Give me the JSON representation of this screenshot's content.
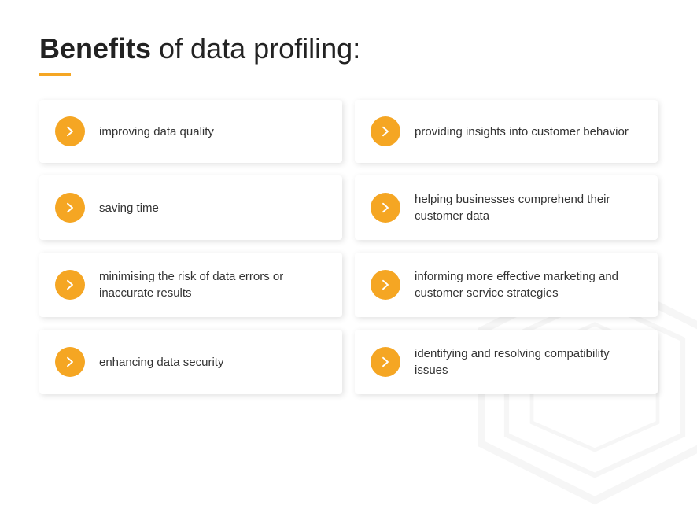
{
  "title": {
    "bold": "Benefits",
    "rest": " of data profiling:"
  },
  "cards": [
    {
      "id": "card-1",
      "text": "improving data quality"
    },
    {
      "id": "card-2",
      "text": "providing insights into customer behavior"
    },
    {
      "id": "card-3",
      "text": "saving time"
    },
    {
      "id": "card-4",
      "text": "helping businesses comprehend their customer data"
    },
    {
      "id": "card-5",
      "text": "minimising the risk of data errors or inaccurate results"
    },
    {
      "id": "card-6",
      "text": "informing more effective marketing and customer service strategies"
    },
    {
      "id": "card-7",
      "text": "enhancing data security"
    },
    {
      "id": "card-8",
      "text": "identifying and resolving compatibility issues"
    }
  ]
}
